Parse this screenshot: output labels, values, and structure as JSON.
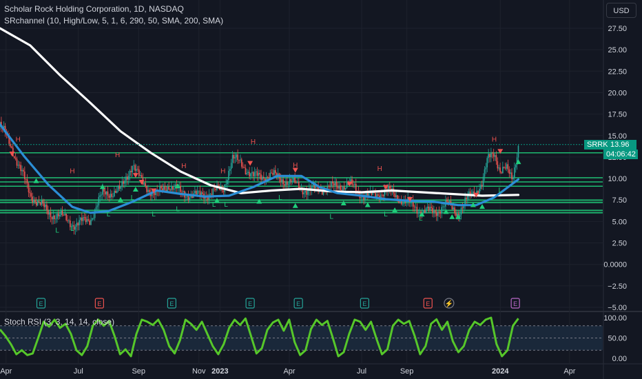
{
  "header": {
    "symbol_title": "Scholar Rock Holding Corporation, 1D, NASDAQ",
    "indicator": "SRchannel (10, High/Low, 5, 1, 6, 290, 50, SMA, 200, SMA)",
    "currency_button": "USD"
  },
  "price_tag": {
    "symbol": "SRRK",
    "price": "13.96",
    "countdown": "04:06:42"
  },
  "colors": {
    "background": "#131722",
    "grid": "#1e222d",
    "candle_up": "#26a69a",
    "candle_down": "#ef5350",
    "channel": "#1fce7a",
    "sma_fast": "#2b8ed6",
    "sma_slow": "#ffffff",
    "rsi_line": "#56c72a",
    "rsi_band": "#1c2a3d",
    "earnings_past": "#26a69a",
    "earnings_red": "#ef5350",
    "earnings_future": "#ba68c8"
  },
  "chart_data": [
    {
      "type": "candlestick",
      "title": "Scholar Rock Holding Corporation, 1D, NASDAQ",
      "y_ticks": [
        "27.50",
        "25.00",
        "22.50",
        "20.00",
        "17.50",
        "15.00",
        "12.50",
        "10.00",
        "7.50",
        "5.00",
        "2.50",
        "0.0000",
        "−2.50",
        "−5.00"
      ],
      "ylim": [
        -5,
        28.8
      ],
      "x_ticks": [
        "Apr",
        "Jul",
        "Sep",
        "Nov",
        "2023",
        "Apr",
        "Jul",
        "Sep",
        "2024",
        "Apr"
      ],
      "last_price": 13.96,
      "channel_levels": [
        13.0,
        10.1,
        9.6,
        9.1,
        7.5,
        7.2,
        6.3,
        6.0
      ],
      "price_path": [
        [
          0,
          16.3
        ],
        [
          0.02,
          13.5
        ],
        [
          0.05,
          8.2
        ],
        [
          0.08,
          6.0
        ],
        [
          0.1,
          5.6
        ],
        [
          0.125,
          4.6
        ],
        [
          0.15,
          5.3
        ],
        [
          0.17,
          8.2
        ],
        [
          0.2,
          8.6
        ],
        [
          0.22,
          11.8
        ],
        [
          0.235,
          9.5
        ],
        [
          0.26,
          8.1
        ],
        [
          0.28,
          9.3
        ],
        [
          0.3,
          8.3
        ],
        [
          0.33,
          8.0
        ],
        [
          0.35,
          8.4
        ],
        [
          0.37,
          8.7
        ],
        [
          0.385,
          12.3
        ],
        [
          0.4,
          11.8
        ],
        [
          0.42,
          10.2
        ],
        [
          0.45,
          10.4
        ],
        [
          0.48,
          9.6
        ],
        [
          0.51,
          8.6
        ],
        [
          0.54,
          8.9
        ],
        [
          0.58,
          9.3
        ],
        [
          0.6,
          8.2
        ],
        [
          0.62,
          7.9
        ],
        [
          0.64,
          8.7
        ],
        [
          0.66,
          7.8
        ],
        [
          0.7,
          6.2
        ],
        [
          0.72,
          6.1
        ],
        [
          0.74,
          7.0
        ],
        [
          0.76,
          6.0
        ],
        [
          0.78,
          8.0
        ],
        [
          0.8,
          9.4
        ],
        [
          0.81,
          12.3
        ],
        [
          0.82,
          13.2
        ],
        [
          0.83,
          10.8
        ],
        [
          0.84,
          11.0
        ],
        [
          0.85,
          10.1
        ],
        [
          0.86,
          13.8
        ]
      ],
      "fast_sma": [
        [
          0,
          16.3
        ],
        [
          0.04,
          12.6
        ],
        [
          0.08,
          9.3
        ],
        [
          0.12,
          6.7
        ],
        [
          0.15,
          6.0
        ],
        [
          0.18,
          6.2
        ],
        [
          0.22,
          7.3
        ],
        [
          0.26,
          8.6
        ],
        [
          0.3,
          8.2
        ],
        [
          0.34,
          7.9
        ],
        [
          0.38,
          8.0
        ],
        [
          0.42,
          9.0
        ],
        [
          0.46,
          10.3
        ],
        [
          0.5,
          10.3
        ],
        [
          0.53,
          9.0
        ],
        [
          0.56,
          8.3
        ],
        [
          0.6,
          8.0
        ],
        [
          0.64,
          7.6
        ],
        [
          0.68,
          7.4
        ],
        [
          0.72,
          7.3
        ],
        [
          0.76,
          6.9
        ],
        [
          0.79,
          6.9
        ],
        [
          0.82,
          7.8
        ],
        [
          0.86,
          9.9
        ]
      ],
      "slow_sma": [
        [
          0,
          27.5
        ],
        [
          0.05,
          25.5
        ],
        [
          0.1,
          22.0
        ],
        [
          0.15,
          18.8
        ],
        [
          0.2,
          15.5
        ],
        [
          0.25,
          13.0
        ],
        [
          0.3,
          10.8
        ],
        [
          0.35,
          9.2
        ],
        [
          0.4,
          8.3
        ],
        [
          0.45,
          8.6
        ],
        [
          0.5,
          8.8
        ],
        [
          0.55,
          8.5
        ],
        [
          0.6,
          8.4
        ],
        [
          0.65,
          8.6
        ],
        [
          0.7,
          8.4
        ],
        [
          0.75,
          8.2
        ],
        [
          0.8,
          8.0
        ],
        [
          0.86,
          8.1
        ]
      ],
      "hl_labels": [
        {
          "t": "H",
          "x": 0.03,
          "y": 14.3
        },
        {
          "t": "L",
          "x": 0.095,
          "y": 3.7
        },
        {
          "t": "H",
          "x": 0.12,
          "y": 10.6
        },
        {
          "t": "L",
          "x": 0.12,
          "y": 3.9
        },
        {
          "t": "H",
          "x": 0.195,
          "y": 12.5
        },
        {
          "t": "L",
          "x": 0.18,
          "y": 5.6
        },
        {
          "t": "L",
          "x": 0.22,
          "y": 7.5
        },
        {
          "t": "L",
          "x": 0.255,
          "y": 5.6
        },
        {
          "t": "H",
          "x": 0.305,
          "y": 11.2
        },
        {
          "t": "L",
          "x": 0.295,
          "y": 6.2
        },
        {
          "t": "L",
          "x": 0.355,
          "y": 6.7
        },
        {
          "t": "L",
          "x": 0.375,
          "y": 6.7
        },
        {
          "t": "H",
          "x": 0.37,
          "y": 10.6
        },
        {
          "t": "H",
          "x": 0.42,
          "y": 14.0
        },
        {
          "t": "H",
          "x": 0.49,
          "y": 11.3
        },
        {
          "t": "L",
          "x": 0.465,
          "y": 7.5
        },
        {
          "t": "H",
          "x": 0.63,
          "y": 10.9
        },
        {
          "t": "L",
          "x": 0.55,
          "y": 5.3
        },
        {
          "t": "L",
          "x": 0.64,
          "y": 5.6
        },
        {
          "t": "L",
          "x": 0.698,
          "y": 5.1
        },
        {
          "t": "H",
          "x": 0.82,
          "y": 14.3
        },
        {
          "t": "L",
          "x": 0.83,
          "y": 8.4
        }
      ],
      "up_arrows": [
        [
          0.06,
          9.8
        ],
        [
          0.17,
          9.1
        ],
        [
          0.2,
          7.6
        ],
        [
          0.225,
          8.8
        ],
        [
          0.295,
          9.2
        ],
        [
          0.36,
          7.5
        ],
        [
          0.43,
          7.4
        ],
        [
          0.49,
          6.9
        ],
        [
          0.57,
          7.2
        ],
        [
          0.61,
          7.0
        ],
        [
          0.655,
          6.4
        ],
        [
          0.7,
          5.9
        ],
        [
          0.74,
          6.2
        ],
        [
          0.75,
          5.6
        ],
        [
          0.76,
          5.6
        ],
        [
          0.785,
          7.0
        ],
        [
          0.8,
          6.8
        ],
        [
          0.86,
          12.0
        ]
      ],
      "down_arrows": [
        [
          0.02,
          12.9
        ],
        [
          0.225,
          10.4
        ],
        [
          0.235,
          9.6
        ],
        [
          0.255,
          8.6
        ],
        [
          0.415,
          11.8
        ],
        [
          0.49,
          11.0
        ],
        [
          0.58,
          9.4
        ],
        [
          0.64,
          9.0
        ],
        [
          0.68,
          7.6
        ],
        [
          0.79,
          8.1
        ],
        [
          0.83,
          13.2
        ]
      ]
    },
    {
      "type": "line",
      "title": "Stoch RSI (3, 3, 14, 14, close)",
      "y_ticks": [
        "100.00",
        "50.00",
        "0.00"
      ],
      "ylim": [
        -10,
        110
      ],
      "band": [
        20,
        80
      ],
      "values": [
        71,
        55,
        35,
        10,
        20,
        8,
        12,
        50,
        90,
        78,
        95,
        75,
        85,
        60,
        20,
        8,
        30,
        80,
        95,
        80,
        92,
        55,
        10,
        22,
        5,
        60,
        95,
        90,
        82,
        95,
        70,
        30,
        12,
        45,
        95,
        85,
        70,
        90,
        60,
        30,
        10,
        35,
        75,
        95,
        82,
        98,
        55,
        12,
        25,
        70,
        88,
        95,
        68,
        95,
        40,
        8,
        20,
        72,
        95,
        82,
        92,
        50,
        5,
        15,
        60,
        95,
        90,
        70,
        90,
        48,
        10,
        22,
        80,
        95,
        85,
        92,
        55,
        10,
        30,
        85,
        96,
        70,
        90,
        42,
        15,
        30,
        70,
        90,
        82,
        95,
        100,
        35,
        5,
        20,
        80,
        98
      ]
    }
  ],
  "events": [
    {
      "kind": "past",
      "x": 0.068
    },
    {
      "kind": "red",
      "x": 0.165
    },
    {
      "kind": "past",
      "x": 0.285
    },
    {
      "kind": "past",
      "x": 0.415
    },
    {
      "kind": "past",
      "x": 0.495
    },
    {
      "kind": "past",
      "x": 0.605
    },
    {
      "kind": "red",
      "x": 0.71
    },
    {
      "kind": "flash",
      "x": 0.745
    },
    {
      "kind": "future",
      "x": 0.855
    }
  ],
  "event_glyph": "E",
  "flash_glyph": "⚡"
}
